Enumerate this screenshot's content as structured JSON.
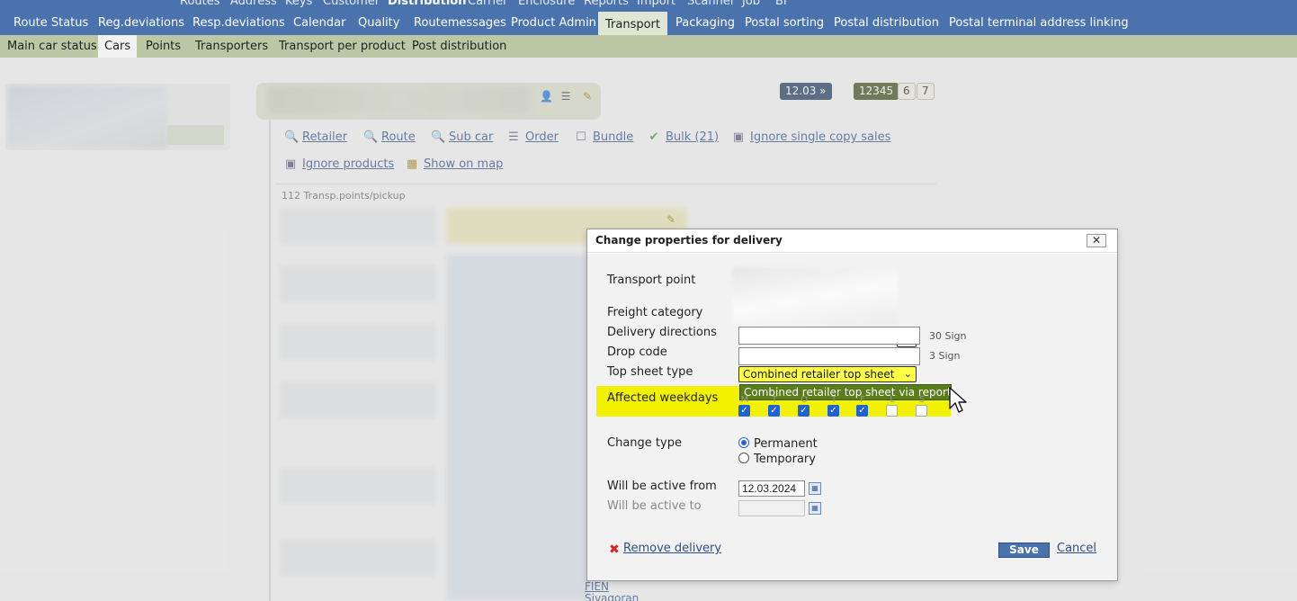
{
  "top_nav_partial": [
    "Routes",
    "Address",
    "Keys",
    "Customer",
    "Distribution",
    "Carrier",
    "Enclosure",
    "Reports",
    "Import",
    "Scanner",
    "Job",
    "BI"
  ],
  "main_nav": [
    "Route Status",
    "Reg.deviations",
    "Resp.deviations",
    "Calendar",
    "Quality",
    "Routemessages",
    "Product Admin",
    "Transport",
    "Packaging",
    "Postal sorting",
    "Postal distribution",
    "Postal terminal address linking"
  ],
  "main_nav_active": "Transport",
  "sub_nav": [
    "Main car status",
    "Cars",
    "Points",
    "Transporters",
    "Transport per product",
    "Post distribution"
  ],
  "sub_nav_active": "Cars",
  "date_chip": "12.03 »",
  "number_chips": [
    "12345",
    "6",
    "7"
  ],
  "actions": [
    "Retailer",
    "Route",
    "Sub car",
    "Order",
    "Bundle",
    "Bulk (21)",
    "Ignore single copy sales",
    "Ignore products",
    "Show on map"
  ],
  "transp_count": "112 Transp.points/pickup",
  "bottom_text": [
    "FIEN",
    "Sivagoran"
  ],
  "dialog": {
    "title": "Change properties for delivery",
    "close": "✕",
    "transport_point_label": "Transport point",
    "freight_category_label": "Freight category",
    "delivery_directions_label": "Delivery directions",
    "delivery_directions_value": "",
    "delivery_directions_hint": "30 Sign",
    "drop_code_label": "Drop code",
    "drop_code_value": "",
    "drop_code_hint": "3 Sign",
    "top_sheet_label": "Top sheet type",
    "top_sheet_value": "Combined retailer top sheet",
    "top_sheet_option_hover": "Combined retailer top sheet via report",
    "affected_weekdays_label": "Affected weekdays",
    "weekdays": [
      "M",
      "T",
      "O",
      "T",
      "F",
      "L",
      "S"
    ],
    "weekdays_checked": [
      true,
      true,
      true,
      true,
      true,
      false,
      false
    ],
    "change_type_label": "Change type",
    "change_type_options": [
      "Permanent",
      "Temporary"
    ],
    "change_type_selected": "Permanent",
    "active_from_label": "Will be active from",
    "active_from_value": "12.03.2024",
    "active_to_label": "Will be active to",
    "active_to_value": "",
    "remove_label": "Remove delivery",
    "save_label": "Save",
    "cancel_label": "Cancel"
  },
  "colors": {
    "nav_blue": "#4a72ad",
    "subnav_green": "#bcc7a6",
    "highlight_yellow": "#f2f200",
    "dropdown_green": "#5a7f1a",
    "link_blue": "#2c4f86"
  }
}
